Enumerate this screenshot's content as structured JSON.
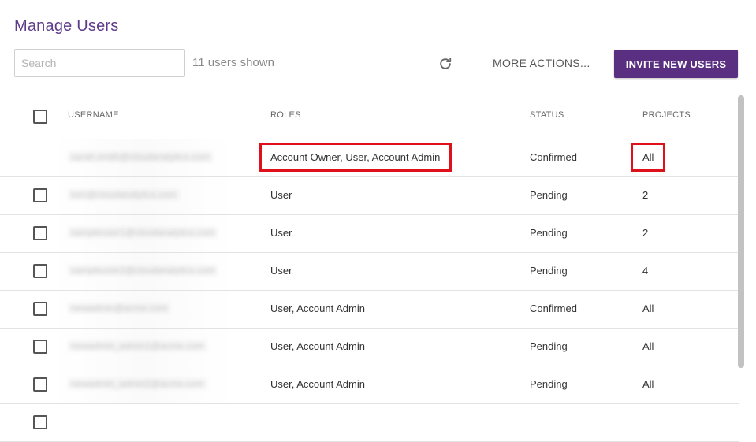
{
  "page": {
    "title": "Manage Users"
  },
  "toolbar": {
    "search_placeholder": "Search",
    "search_value": "",
    "users_count": "11 users shown",
    "refresh_icon": "refresh-icon",
    "more_actions_label": "MORE ACTIONS...",
    "invite_label": "INVITE NEW USERS",
    "accent_color": "#5a2f82"
  },
  "table": {
    "headers": {
      "username": "USERNAME",
      "roles": "ROLES",
      "status": "STATUS",
      "projects": "PROJECTS"
    },
    "rows": [
      {
        "username": "sarah.smith@cloudanalytics.com",
        "roles": "Account Owner, User, Account Admin",
        "status": "Confirmed",
        "projects": "All",
        "has_checkbox": false
      },
      {
        "username": "tom@cloudanalytics.com",
        "roles": "User",
        "status": "Pending",
        "projects": "2",
        "has_checkbox": true
      },
      {
        "username": "sampleuser1@cloudanalytics.com",
        "roles": "User",
        "status": "Pending",
        "projects": "2",
        "has_checkbox": true
      },
      {
        "username": "sampleuser2@cloudanalytics.com",
        "roles": "User",
        "status": "Pending",
        "projects": "4",
        "has_checkbox": true
      },
      {
        "username": "newadmin@acme.com",
        "roles": "User, Account Admin",
        "status": "Confirmed",
        "projects": "All",
        "has_checkbox": true
      },
      {
        "username": "newadmin_admin1@acme.com",
        "roles": "User, Account Admin",
        "status": "Pending",
        "projects": "All",
        "has_checkbox": true
      },
      {
        "username": "newadmin_admin2@acme.com",
        "roles": "User, Account Admin",
        "status": "Pending",
        "projects": "All",
        "has_checkbox": true
      }
    ]
  },
  "annotations": {
    "highlight_color": "#e0101a"
  }
}
